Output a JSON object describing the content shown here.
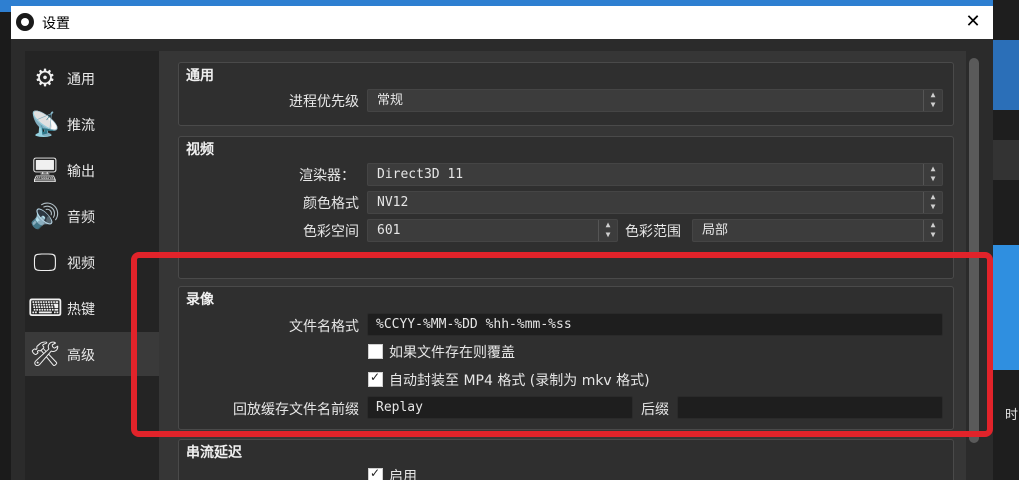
{
  "window": {
    "title": "设置",
    "close_glyph": "✕"
  },
  "sidebar": {
    "items": [
      {
        "label": "通用",
        "icon": "gear-icon",
        "glyph": "⚙",
        "active": false
      },
      {
        "label": "推流",
        "icon": "broadcast-icon",
        "glyph": "📡",
        "active": false
      },
      {
        "label": "输出",
        "icon": "output-icon",
        "glyph": "🖥",
        "active": false
      },
      {
        "label": "音频",
        "icon": "speaker-icon",
        "glyph": "🔊",
        "active": false
      },
      {
        "label": "视频",
        "icon": "monitor-icon",
        "glyph": "🖵",
        "active": false
      },
      {
        "label": "热键",
        "icon": "keyboard-icon",
        "glyph": "⌨",
        "active": false
      },
      {
        "label": "高级",
        "icon": "tools-icon",
        "glyph": "🛠",
        "active": true
      }
    ]
  },
  "general": {
    "title": "通用",
    "process_priority_label": "进程优先级",
    "process_priority_value": "常规"
  },
  "video": {
    "title": "视频",
    "renderer_label": "渲染器：",
    "renderer_value": "Direct3D 11",
    "color_format_label": "颜色格式",
    "color_format_value": "NV12",
    "color_space_label": "色彩空间",
    "color_space_value": "601",
    "color_range_label": "色彩范围",
    "color_range_value": "局部"
  },
  "recording": {
    "title": "录像",
    "filename_format_label": "文件名格式",
    "filename_format_value": "%CCYY-%MM-%DD %hh-%mm-%ss",
    "overwrite_label": "如果文件存在则覆盖",
    "overwrite_checked": false,
    "automux_label": "自动封装至 MP4 格式 (录制为 mkv 格式)",
    "automux_checked": true,
    "replay_prefix_label": "回放缓存文件名前缀",
    "replay_prefix_value": "Replay",
    "suffix_label": "后缀",
    "suffix_value": ""
  },
  "stream_delay": {
    "title": "串流延迟",
    "enable_label": "启用",
    "enable_checked": true
  },
  "desktop": {
    "side_glyph": "时"
  },
  "colors": {
    "annotation": "#e1232a",
    "background": "#2b2b2b"
  }
}
